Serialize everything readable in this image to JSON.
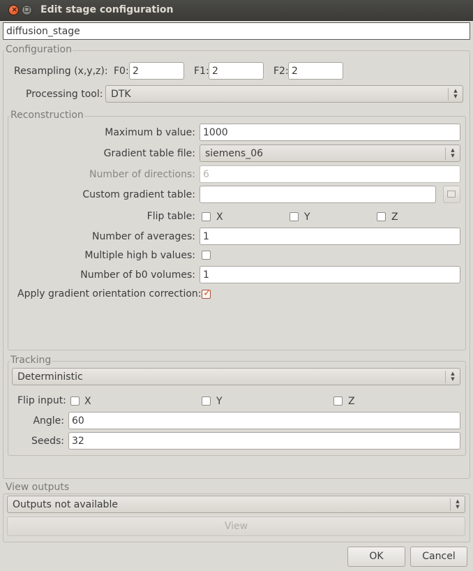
{
  "window": {
    "title": "Edit stage configuration"
  },
  "stage_name": "diffusion_stage",
  "configuration": {
    "group_title": "Configuration",
    "resampling_label": "Resampling (x,y,z):",
    "f0_label": "F0:",
    "f0_value": "2",
    "f1_label": "F1:",
    "f1_value": "2",
    "f2_label": "F2:",
    "f2_value": "2",
    "processing_tool_label": "Processing tool:",
    "processing_tool_value": "DTK"
  },
  "reconstruction": {
    "group_title": "Reconstruction",
    "max_b_label": "Maximum b value:",
    "max_b_value": "1000",
    "gradient_table_label": "Gradient table file:",
    "gradient_table_value": "siemens_06",
    "num_directions_label": "Number of directions:",
    "num_directions_value": "6",
    "custom_gradient_label": "Custom gradient table:",
    "custom_gradient_value": "",
    "flip_table_label": "Flip table:",
    "flip_x": "X",
    "flip_y": "Y",
    "flip_z": "Z",
    "num_averages_label": "Number of averages:",
    "num_averages_value": "1",
    "multiple_high_b_label": "Multiple high b values:",
    "num_b0_label": "Number of b0 volumes:",
    "num_b0_value": "1",
    "apply_correction_label": "Apply gradient orientation correction:"
  },
  "tracking": {
    "group_title": "Tracking",
    "method_value": "Deterministic",
    "flip_input_label": "Flip input:",
    "flip_x": "X",
    "flip_y": "Y",
    "flip_z": "Z",
    "angle_label": "Angle:",
    "angle_value": "60",
    "seeds_label": "Seeds:",
    "seeds_value": "32"
  },
  "view_outputs": {
    "group_title": "View outputs",
    "outputs_value": "Outputs not available",
    "view_label": "View"
  },
  "buttons": {
    "ok_label": "OK",
    "cancel_label": "Cancel"
  }
}
